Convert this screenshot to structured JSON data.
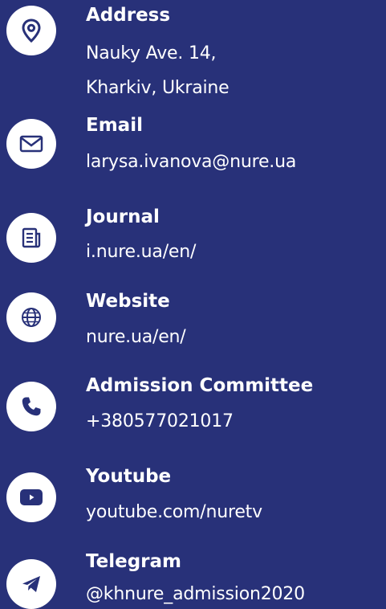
{
  "contacts": {
    "address": {
      "icon": "location-pin-icon",
      "label": "Address",
      "line1": "Nauky Ave. 14,",
      "line2": "Kharkiv, Ukraine"
    },
    "email": {
      "icon": "envelope-icon",
      "label": "Email",
      "value": "larysa.ivanova@nure.ua"
    },
    "journal": {
      "icon": "newspaper-icon",
      "label": "Journal",
      "value": "i.nure.ua/en/"
    },
    "website": {
      "icon": "globe-icon",
      "label": "Website",
      "value": "nure.ua/en/"
    },
    "admission": {
      "icon": "phone-icon",
      "label": "Admission Committee",
      "value": "+380577021017"
    },
    "youtube": {
      "icon": "youtube-icon",
      "label": "Youtube",
      "value": "youtube.com/nuretv"
    },
    "telegram": {
      "icon": "telegram-icon",
      "label": "Telegram",
      "value": "@khnure_admission2020"
    }
  },
  "colors": {
    "background": "#283179",
    "icon_circle": "#ffffff",
    "icon_glyph": "#283179",
    "text": "#ffffff"
  }
}
